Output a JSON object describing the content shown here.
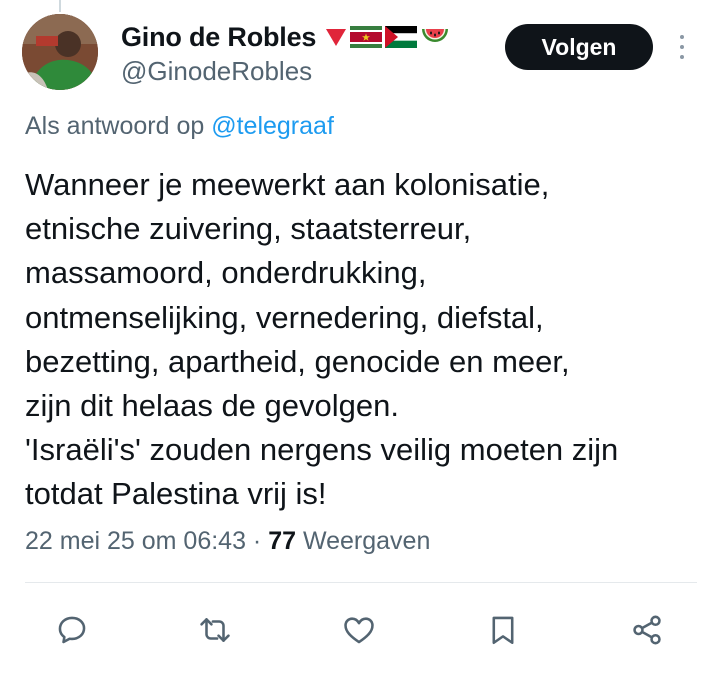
{
  "author": {
    "display_name": "Gino de Robles",
    "handle": "@GinodeRobles",
    "badges": [
      "down-triangle-red",
      "flag-suriname",
      "flag-palestine",
      "watermelon"
    ]
  },
  "follow_label": "Volgen",
  "reply": {
    "prefix": "Als antwoord op ",
    "mention": "@telegraaf"
  },
  "tweet": {
    "lines": [
      "Wanneer je meewerkt aan kolonisatie,",
      "etnische zuivering, staatsterreur,",
      "massamoord, onderdrukking,",
      "ontmenselijking, vernedering, diefstal,",
      "bezetting, apartheid, genocide en meer,",
      "zijn dit helaas de gevolgen.",
      "'Israëli's' zouden nergens veilig moeten zijn",
      "totdat Palestina vrij is!"
    ]
  },
  "meta": {
    "timestamp": "22 mei 25 om 06:43",
    "separator": " · ",
    "views_count": "77",
    "views_label": " Weergaven"
  },
  "actions": [
    "reply-icon",
    "retweet-icon",
    "like-icon",
    "bookmark-icon",
    "share-icon"
  ],
  "colors": {
    "text": "#0f1419",
    "secondary": "#536471",
    "link": "#1d9bf0",
    "button_bg": "#0f1419",
    "button_text": "#ffffff"
  }
}
